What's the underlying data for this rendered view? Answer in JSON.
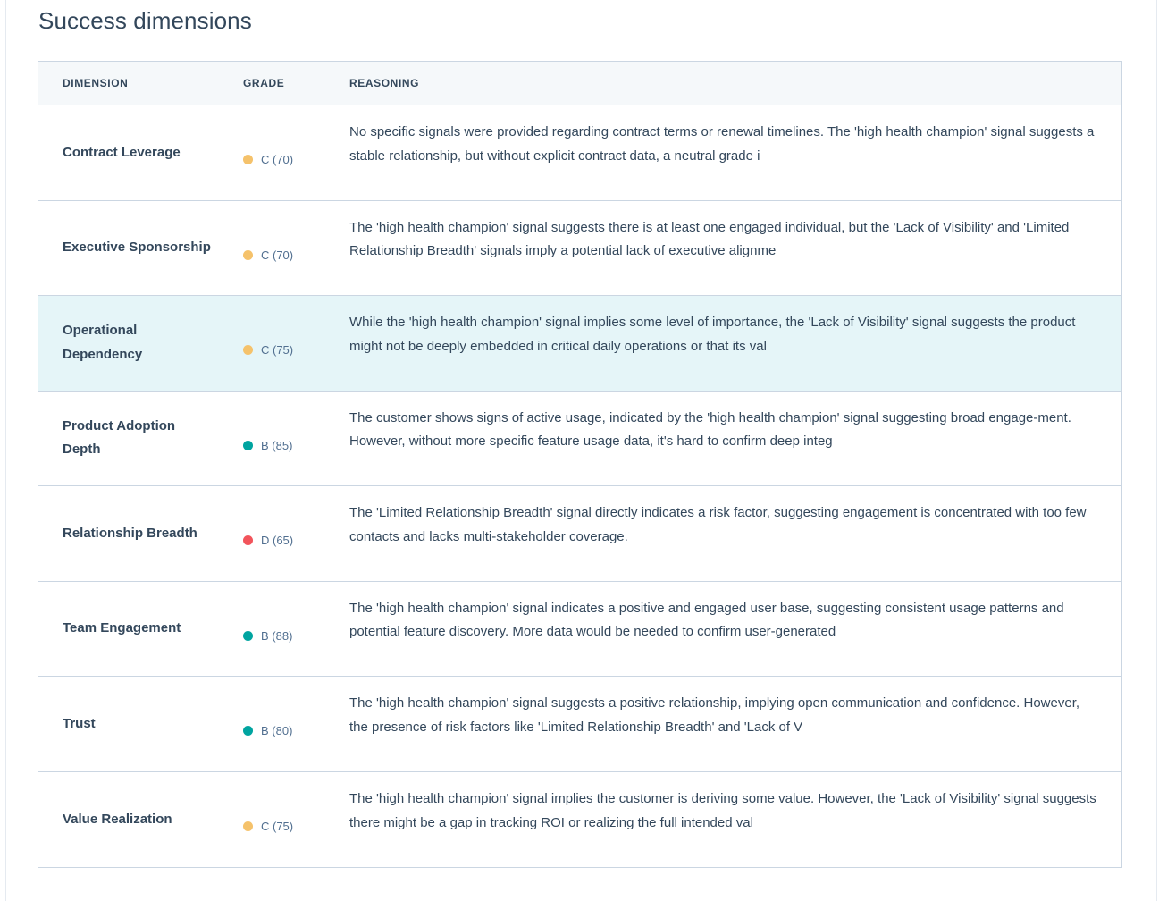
{
  "page": {
    "title": "Success dimensions"
  },
  "table": {
    "headers": {
      "dimension": "DIMENSION",
      "grade": "GRADE",
      "reasoning": "REASONING"
    },
    "rows": [
      {
        "dimension": "Contract Leverage",
        "grade": "C (70)",
        "grade_color": "#f5c26b",
        "reasoning": "No specific signals were provided regarding contract terms or renewal timelines. The 'high health champion' signal suggests a stable relationship, but without explicit contract data, a neutral grade i",
        "highlighted": false
      },
      {
        "dimension": "Executive Sponsorship",
        "grade": "C (70)",
        "grade_color": "#f5c26b",
        "reasoning": "The 'high health champion' signal suggests there is at least one engaged individual, but the 'Lack of Visibility' and 'Limited Relationship Breadth' signals imply a potential lack of executive alignme",
        "highlighted": false
      },
      {
        "dimension": "Operational Dependency",
        "grade": "C (75)",
        "grade_color": "#f5c26b",
        "reasoning": "While the 'high health champion' signal implies some level of importance, the 'Lack of Visibility' signal suggests the product might not be deeply embedded in critical daily operations or that its val",
        "highlighted": true
      },
      {
        "dimension": "Product Adoption Depth",
        "grade": "B (85)",
        "grade_color": "#00a4a0",
        "reasoning": "The customer shows signs of active usage, indicated by the 'high health champion' signal suggesting broad engage-ment. However, without more specific feature usage data, it's hard to confirm deep integ",
        "highlighted": false
      },
      {
        "dimension": "Relationship Breadth",
        "grade": "D (65)",
        "grade_color": "#f2545b",
        "reasoning": "The 'Limited Relationship Breadth' signal directly indicates a risk factor, suggesting engagement is concentrated with too few contacts and lacks multi-stakeholder coverage.",
        "highlighted": false
      },
      {
        "dimension": "Team Engagement",
        "grade": "B (88)",
        "grade_color": "#00a4a0",
        "reasoning": "The 'high health champion' signal indicates a positive and engaged user base, suggesting consistent usage patterns and potential feature discovery. More data would be needed to confirm user-generated",
        "highlighted": false
      },
      {
        "dimension": "Trust",
        "grade": "B (80)",
        "grade_color": "#00a4a0",
        "reasoning": "The 'high health champion' signal suggests a positive relationship, implying open communication and confidence. However, the presence of risk factors like 'Limited Relationship Breadth' and 'Lack of V",
        "highlighted": false
      },
      {
        "dimension": "Value Realization",
        "grade": "C (75)",
        "grade_color": "#f5c26b",
        "reasoning": "The 'high health champion' signal implies the customer is deriving some value. However, the 'Lack of Visibility' signal suggests there might be a gap in tracking ROI or realizing the full intended val",
        "highlighted": false
      }
    ]
  }
}
